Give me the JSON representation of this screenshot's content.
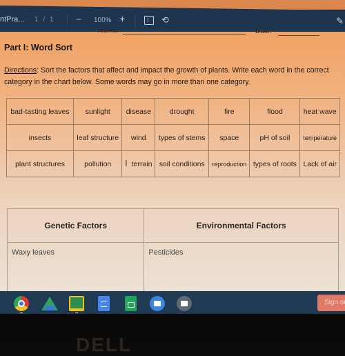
{
  "toolbar": {
    "doc_title": "ntPra...",
    "page_current": "1",
    "page_sep": "/",
    "page_total": "1",
    "zoom_out": "−",
    "zoom_level": "100%",
    "zoom_in": "+",
    "fit_icon": "fit-page-icon",
    "rotate_icon": "rotate-icon",
    "annotate_icon": "pen-icon"
  },
  "document": {
    "name_label": "Name:",
    "date_label": "Date:",
    "part_title": "Part I: Word Sort",
    "directions_label": "Directions",
    "directions_text": ": Sort the factors that affect and impact the growth of plants. Write each word in the correct category in the chart below. Some words may go in more than one category.",
    "word_bank": [
      [
        "bad-tasting leaves",
        "sunlight",
        "disease",
        "drought",
        "fire",
        "flood",
        "heat wave"
      ],
      [
        "insects",
        "leaf structure",
        "wind",
        "types of stems",
        "space",
        "pH of soil",
        "temperature"
      ],
      [
        "plant structures",
        "pollution",
        "terrain",
        "soil conditions",
        "reproduction",
        "types of roots",
        "Lack of air"
      ]
    ],
    "factors_table": {
      "headers": [
        "Genetic Factors",
        "Environmental Factors"
      ],
      "entries": [
        "Waxy leaves",
        "Pesticides"
      ]
    }
  },
  "shelf": {
    "apps": [
      "Chrome",
      "Google Drive",
      "Google Classroom",
      "Google Docs",
      "Google Sheets",
      "Files",
      "Camera"
    ],
    "sign_out": "Sign out"
  },
  "bezel": {
    "logo": "DELL"
  }
}
